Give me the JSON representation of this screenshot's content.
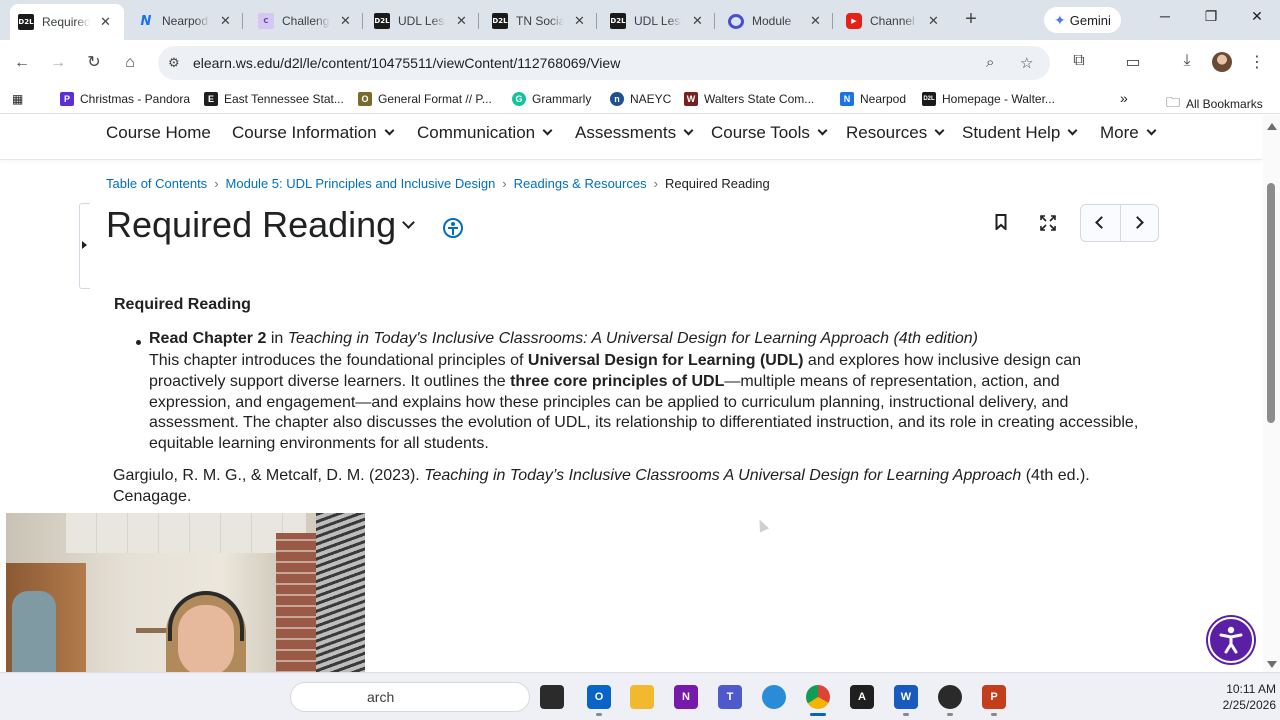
{
  "browser": {
    "tabs": [
      {
        "label": "Required Reading",
        "favicon": "D2L",
        "active": true
      },
      {
        "label": "Nearpod",
        "favicon": "N",
        "active": false
      },
      {
        "label": "Challenge",
        "favicon": "C",
        "active": false
      },
      {
        "label": "UDL Lesson",
        "favicon": "D2L",
        "active": false
      },
      {
        "label": "TN Social",
        "favicon": "D2L",
        "active": false
      },
      {
        "label": "UDL Lesson",
        "favicon": "D2L",
        "active": false
      },
      {
        "label": "Module",
        "favicon": "Q",
        "active": false
      },
      {
        "label": "Channel",
        "favicon": "YT",
        "active": false
      }
    ],
    "new_tab_symbol": "+",
    "gemini_label": "Gemini",
    "url": "elearn.ws.edu/d2l/le/content/10475511/viewContent/112768069/View",
    "bookmarks": [
      {
        "label": "Christmas - Pandora",
        "icon": "pandora-icon",
        "color": "#5b2fd6"
      },
      {
        "label": "East Tennessee Stat...",
        "icon": "etsu-icon",
        "color": "#1f1f1f"
      },
      {
        "label": "General Format // P...",
        "icon": "purdue-owl-icon",
        "color": "#7a6b2c"
      },
      {
        "label": "Grammarly",
        "icon": "grammarly-icon",
        "color": "#15c39a"
      },
      {
        "label": "NAEYC",
        "icon": "naeyc-icon",
        "color": "#1d4f91"
      },
      {
        "label": "Walters State Com...",
        "icon": "walters-state-icon",
        "color": "#7a1f1f"
      },
      {
        "label": "Nearpod",
        "icon": "nearpod-icon",
        "color": "#1a73e8"
      },
      {
        "label": "Homepage - Walter...",
        "icon": "d2l-icon",
        "color": "#1a1a1a"
      }
    ],
    "bookmarks_overflow": "»",
    "all_bookmarks_label": "All Bookmarks"
  },
  "nav": {
    "items": [
      {
        "label": "Course Home",
        "dropdown": false
      },
      {
        "label": "Course Information",
        "dropdown": true
      },
      {
        "label": "Communication",
        "dropdown": true
      },
      {
        "label": "Assessments",
        "dropdown": true
      },
      {
        "label": "Course Tools",
        "dropdown": true
      },
      {
        "label": "Resources",
        "dropdown": true
      },
      {
        "label": "Student Help",
        "dropdown": true
      },
      {
        "label": "More",
        "dropdown": true
      }
    ]
  },
  "breadcrumb": {
    "items": [
      "Table of Contents",
      "Module 5: UDL Principles and Inclusive Design",
      "Readings & Resources"
    ],
    "current": "Required Reading"
  },
  "page": {
    "title": "Required Reading"
  },
  "content": {
    "heading": "Required Reading",
    "bullet": {
      "bold": "Read Chapter 2",
      "mid": " in ",
      "italic": "Teaching in Today's Inclusive Classrooms: A Universal Design for Learning Approach (4th edition)"
    },
    "paragraph": {
      "p1": "This chapter introduces the foundational principles of ",
      "b1": "Universal Design for Learning (UDL)",
      "p2": " and explores how inclusive design can proactively support diverse learners. It outlines the ",
      "b2": "three core principles of UDL",
      "p3": "—multiple means of representation, action, and expression, and engagement—and explains how these principles can be applied to curriculum planning, instructional delivery, and assessment. The chapter also discusses the evolution of UDL, its relationship to differentiated instruction, and its role in creating accessible, equitable learning environments for all students."
    },
    "citation": {
      "authors": "Gargiulo, R. M. G., & Metcalf, D. M. (2023). ",
      "title": "Teaching in Today’s Inclusive Classrooms A Universal Design for Learning Approach",
      "tail": " (4th ed.). Cenagage."
    }
  },
  "taskbar": {
    "search_text": "arch",
    "time": "10:11 AM",
    "date": "2/25/2026"
  },
  "colors": {
    "link": "#006fbf",
    "accessibility_widget": "#5b1fa5",
    "tab_strip": "#dde3ea"
  }
}
